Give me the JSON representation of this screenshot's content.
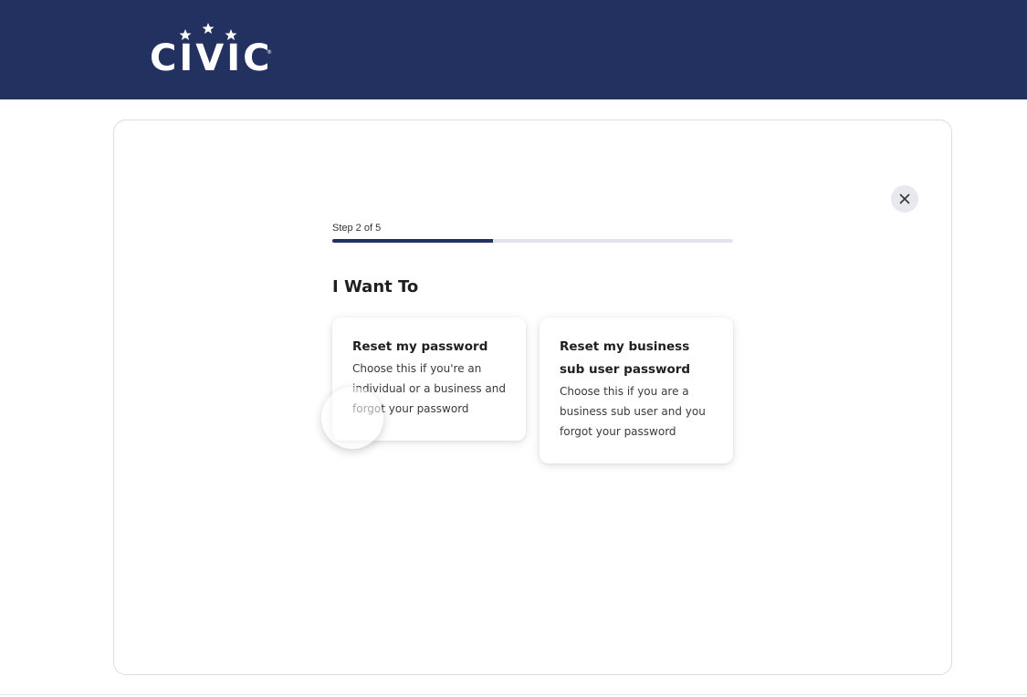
{
  "header": {
    "brand": "CIVIC",
    "brand_mark": "®",
    "background_color": "#22315f"
  },
  "wizard": {
    "step_label": "Step 2 of 5",
    "progress": {
      "current": 2,
      "total": 5,
      "fraction": 0.4
    },
    "close_icon": "close-icon",
    "heading": "I Want To",
    "options": [
      {
        "title": "Reset my password",
        "description": "Choose this if you're an individual or a business and forgot your password"
      },
      {
        "title": "Reset my business sub user password",
        "description": "Choose this if you are a business sub user and you forgot your password"
      }
    ]
  },
  "colors": {
    "accent": "#22315f",
    "track": "#e2e3ea",
    "close_bg": "#e8e9ee"
  }
}
